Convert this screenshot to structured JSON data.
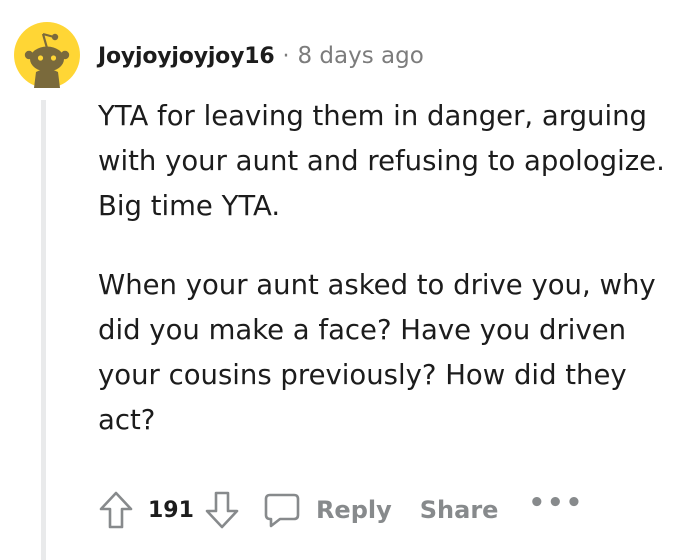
{
  "comment": {
    "author": "Joyjoyjoyjoy16",
    "separator": "·",
    "time_ago": "8 days ago",
    "paragraphs": [
      "YTA for leaving them in danger, arguing with your aunt and refusing to apologize. Big time YTA.",
      "When your aunt asked to drive you, why did you make a face? Have you driven your cousins previously? How did they act?"
    ],
    "score": "191"
  },
  "actions": {
    "reply_label": "Reply",
    "share_label": "Share",
    "more_label": "•••"
  },
  "icons": {
    "avatar": "snoo-avatar-icon",
    "upvote": "arrow-up-icon",
    "downvote": "arrow-down-icon",
    "comment": "speech-bubble-icon"
  },
  "colors": {
    "avatar_bg": "#ffd635",
    "avatar_figure": "#7a6a3c",
    "text": "#1c1c1c",
    "muted": "#878a8c",
    "thread_line": "#e9eaeb"
  }
}
